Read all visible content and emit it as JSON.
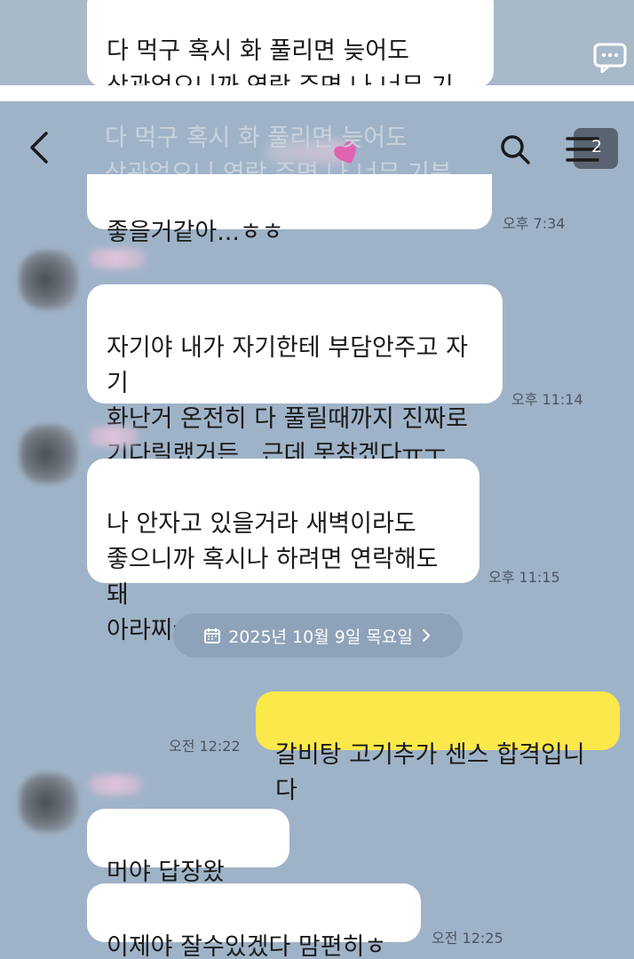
{
  "top_crop": {
    "bubble_text": "다 먹구 혹시 화 풀리면 늦어도\n상관없으니까 연락 주면 나 너무 기분\n좋을거같아...ㅎㅎ"
  },
  "header": {
    "menu_badge": "2"
  },
  "messages": {
    "m1": {
      "text": "좋을거같아...ㅎㅎ",
      "ghost": "다 먹구 혹시 화 풀리면 늦어도\n상관없으니 연락 주면 나 너무 기분",
      "time": "오후 7:34"
    },
    "m2": {
      "text": "자기야 내가 자기한테 부담안주고 자기\n화난거 온전히 다 풀릴때까지 진짜로\n기다릴랬거든...근데 못참겠다ㅠㅜ",
      "time": "오후 11:14"
    },
    "m3": {
      "text": "나 안자고 있을거라 새벽이라도\n좋으니까 혹시나 하려면 연락해도돼\n아라찌ㅠㅜ",
      "time": "오후 11:15"
    },
    "date_divider": "2025년 10월 9일 목요일",
    "m4": {
      "text": "갈비탕 고기추가 센스 합격입니다",
      "time": "오전 12:22"
    },
    "m5": {
      "text": "머야 답장왔다...!"
    },
    "m6": {
      "text": "이제야 잘수있겠다 맘편히ㅎㅎ",
      "time": "오전 12:25"
    }
  },
  "colors": {
    "chat_bg": "#9fb3c8",
    "my_bubble": "#fbe84a",
    "other_bubble": "#ffffff"
  },
  "icons": [
    "back-arrow-icon",
    "search-icon",
    "menu-icon",
    "chat-bubble-icon",
    "calendar-icon",
    "chevron-right-icon"
  ]
}
